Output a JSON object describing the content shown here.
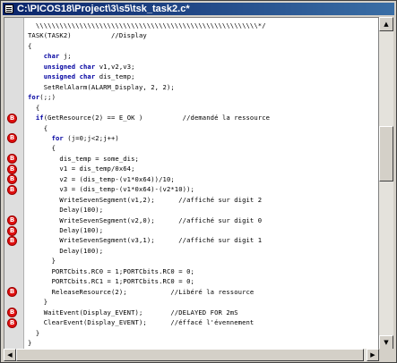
{
  "window": {
    "title": "C:\\PICOS18\\Project\\3\\s5\\tsk_task2.c*"
  },
  "colors": {
    "keyword": "#0000a0",
    "breakpoint": "#e01010",
    "title_bar": "#0a246a"
  },
  "breakpoint_glyph": "B",
  "code_lines": [
    {
      "text": "  \\\\\\\\\\\\\\\\\\\\\\\\\\\\\\\\\\\\\\\\\\\\\\\\\\\\\\\\\\\\\\\\\\\\\\\\\\\\\\\\\\\\\\\\\\\\\\\\\\\\\\\\\\\\\\\\*/",
      "bp": false
    },
    {
      "text": "TASK(TASK2)          //Display",
      "bp": false
    },
    {
      "text": "{",
      "bp": false
    },
    {
      "text": "    char j;",
      "bp": false
    },
    {
      "text": "    unsigned char v1,v2,v3;",
      "bp": false
    },
    {
      "text": "    unsigned char dis_temp;",
      "bp": false
    },
    {
      "text": "    SetRelAlarm(ALARM_Display, 2, 2);",
      "bp": false
    },
    {
      "text": "for(;;)",
      "bp": false
    },
    {
      "text": "  {",
      "bp": false
    },
    {
      "text": "  if(GetResource(2) == E_OK )          //demandé la ressource",
      "bp": true
    },
    {
      "text": "    {",
      "bp": false
    },
    {
      "text": "      for (j=0;j<2;j++)",
      "bp": true
    },
    {
      "text": "      {",
      "bp": false
    },
    {
      "text": "        dis_temp = some_dis;",
      "bp": true
    },
    {
      "text": "        v1 = dis_temp/0x64;",
      "bp": true
    },
    {
      "text": "        v2 = (dis_temp-(v1*0x64))/10;",
      "bp": true
    },
    {
      "text": "        v3 = (dis_temp-(v1*0x64)-(v2*10));",
      "bp": true
    },
    {
      "text": "        WriteSevenSegment(v1,2);      //affiché sur digit 2",
      "bp": false
    },
    {
      "text": "        Delay(100);",
      "bp": false
    },
    {
      "text": "        WriteSevenSegment(v2,0);      //affiché sur digit 0",
      "bp": true
    },
    {
      "text": "        Delay(100);",
      "bp": true
    },
    {
      "text": "        WriteSevenSegment(v3,1);      //affiché sur digit 1",
      "bp": true
    },
    {
      "text": "        Delay(100);",
      "bp": false
    },
    {
      "text": "      }",
      "bp": false
    },
    {
      "text": "      PORTCbits.RC0 = 1;PORTCbits.RC0 = 0;",
      "bp": false
    },
    {
      "text": "      PORTCbits.RC1 = 1;PORTCbits.RC0 = 0;",
      "bp": false
    },
    {
      "text": "      ReleaseResource(2);           //Libéré la ressource",
      "bp": true
    },
    {
      "text": "    }",
      "bp": false
    },
    {
      "text": "    WaitEvent(Display_EVENT);       //DELAYED FOR 2mS",
      "bp": true
    },
    {
      "text": "    ClearEvent(Display_EVENT);      //éffacé l'évennement",
      "bp": true
    },
    {
      "text": "  }",
      "bp": false
    },
    {
      "text": "}",
      "bp": false
    }
  ],
  "scrollbar": {
    "up_arrow": "▲",
    "down_arrow": "▼",
    "left_arrow": "◀",
    "right_arrow": "▶",
    "position_fraction": 0.38
  }
}
